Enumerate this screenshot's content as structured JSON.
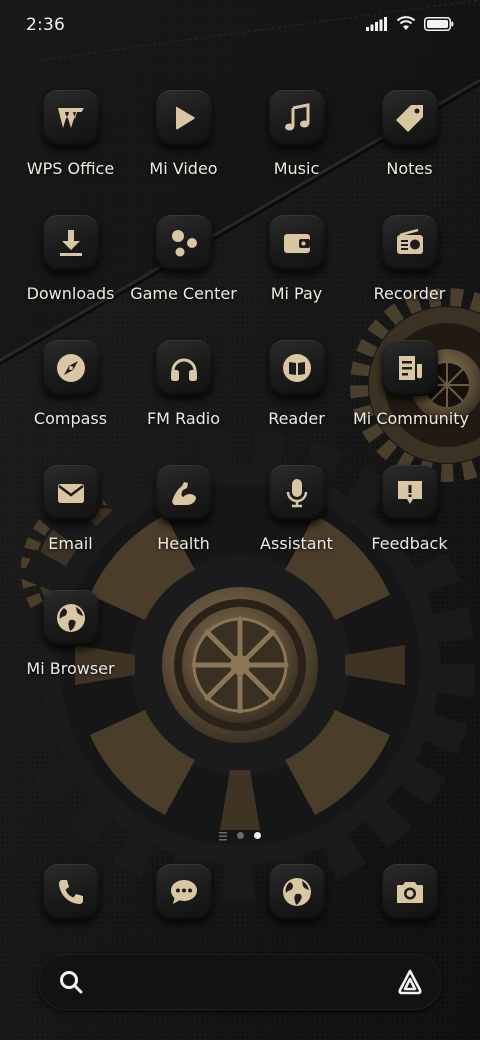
{
  "status_bar": {
    "time": "2:36"
  },
  "apps": [
    {
      "label": "WPS Office",
      "icon": "wps-office-icon"
    },
    {
      "label": "Mi Video",
      "icon": "play-icon"
    },
    {
      "label": "Music",
      "icon": "music-note-icon"
    },
    {
      "label": "Notes",
      "icon": "tag-icon"
    },
    {
      "label": "Downloads",
      "icon": "download-icon"
    },
    {
      "label": "Game Center",
      "icon": "game-dots-icon"
    },
    {
      "label": "Mi Pay",
      "icon": "wallet-icon"
    },
    {
      "label": "Recorder",
      "icon": "radio-icon"
    },
    {
      "label": "Compass",
      "icon": "compass-icon"
    },
    {
      "label": "FM Radio",
      "icon": "headphones-icon"
    },
    {
      "label": "Reader",
      "icon": "book-icon"
    },
    {
      "label": "Mi Community",
      "icon": "document-icon"
    },
    {
      "label": "Email",
      "icon": "envelope-icon"
    },
    {
      "label": "Health",
      "icon": "muscle-arm-icon"
    },
    {
      "label": "Assistant",
      "icon": "microphone-icon"
    },
    {
      "label": "Feedback",
      "icon": "feedback-icon"
    },
    {
      "label": "Mi Browser",
      "icon": "globe-icon"
    }
  ],
  "dock": [
    {
      "icon": "phone-icon"
    },
    {
      "icon": "chat-bubble-icon"
    },
    {
      "icon": "globe-icon"
    },
    {
      "icon": "camera-icon"
    }
  ],
  "pages": {
    "count": 2,
    "current": 2
  },
  "colors": {
    "accent": "#d9c6a2",
    "background": "#141414",
    "tile": "#1d1d1d"
  }
}
